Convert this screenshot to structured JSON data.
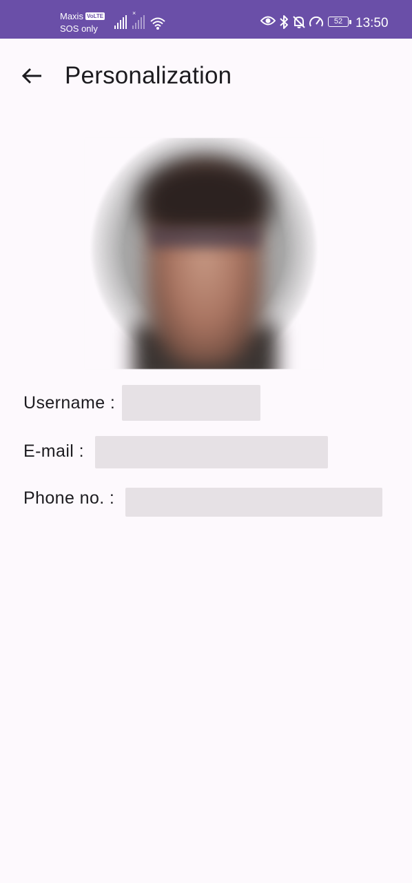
{
  "status_bar": {
    "carrier": "Maxis",
    "volte": "VoLTE",
    "sos": "SOS only",
    "battery": "52",
    "time": "13:50",
    "icons": [
      "signal-icon",
      "signal-no-service-icon",
      "wifi-icon",
      "eye-icon",
      "bluetooth-icon",
      "bell-off-icon",
      "speedometer-icon",
      "battery-icon"
    ]
  },
  "app_bar": {
    "title": "Personalization",
    "back_icon": "arrow-left-icon"
  },
  "profile": {
    "username_label": "Username :",
    "username_value": "",
    "email_label": "E-mail :",
    "email_value": "",
    "phone_label": "Phone no. :",
    "phone_value": ""
  },
  "colors": {
    "status_bar": "#6a4fa8",
    "background": "#fdf9fd",
    "redaction": "#e6e1e5"
  }
}
